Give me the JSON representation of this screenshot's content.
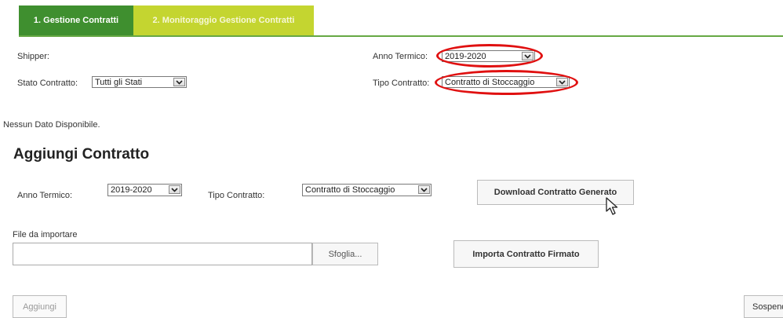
{
  "tabs": [
    {
      "label": "1. Gestione Contratti"
    },
    {
      "label": "2. Monitoraggio Gestione Contratti"
    }
  ],
  "filters": {
    "shipper_label": "Shipper:",
    "anno_label": "Anno Termico:",
    "anno_value": "2019-2020",
    "stato_label": "Stato Contratto:",
    "stato_value": "Tutti gli Stati",
    "tipo_label": "Tipo Contratto:",
    "tipo_value": "Contratto di Stoccaggio"
  },
  "no_data": "Nessun Dato Disponibile.",
  "add_section": {
    "title": "Aggiungi Contratto",
    "anno_label": "Anno Termico:",
    "anno_value": "2019-2020",
    "tipo_label": "Tipo Contratto:",
    "tipo_value": "Contratto di Stoccaggio",
    "download_button": "Download Contratto Generato",
    "file_label": "File da importare",
    "file_value": "",
    "browse_button": "Sfoglia...",
    "import_button": "Importa Contratto Firmato",
    "add_button": "Aggiungi",
    "suspend_button": "Sospend"
  },
  "colors": {
    "tab_active": "#3f8f2f",
    "tab_inactive": "#c4d530",
    "highlight": "#e01010"
  },
  "icons": [
    "chevron-down-icon",
    "mouse-cursor-icon"
  ]
}
